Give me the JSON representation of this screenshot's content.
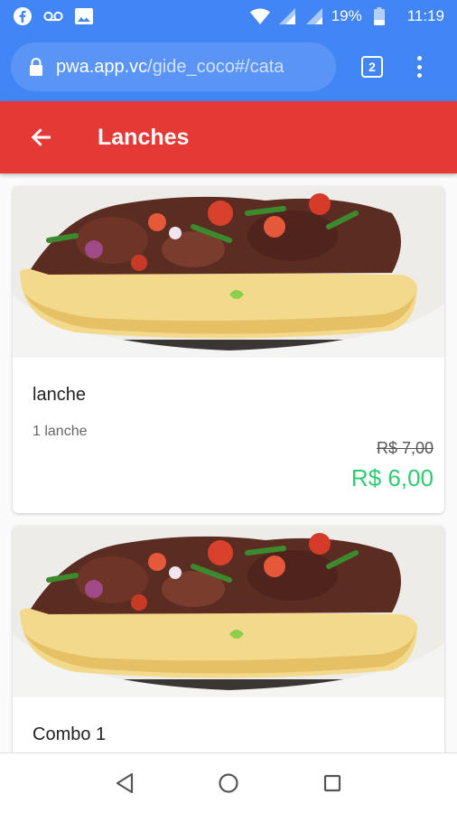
{
  "status_bar": {
    "battery": "19%",
    "time": "11:19",
    "icons": [
      "facebook-icon",
      "voicemail-icon",
      "image-icon",
      "wifi-icon",
      "signal-icon",
      "signal-icon",
      "battery-icon"
    ]
  },
  "browser": {
    "url_host": "pwa.app.vc",
    "url_path": "/gide_coco#/cata",
    "tab_count": "2"
  },
  "header": {
    "title": "Lanches",
    "color": "#e53935"
  },
  "products": [
    {
      "name": "lanche",
      "description": "1 lanche",
      "old_price": "R$ 7,00",
      "price": "R$ 6,00"
    },
    {
      "name": "Combo 1",
      "description": "",
      "old_price": "",
      "price": ""
    }
  ],
  "colors": {
    "browser_bar": "#4285f4",
    "price_accent": "#2ecc71"
  }
}
